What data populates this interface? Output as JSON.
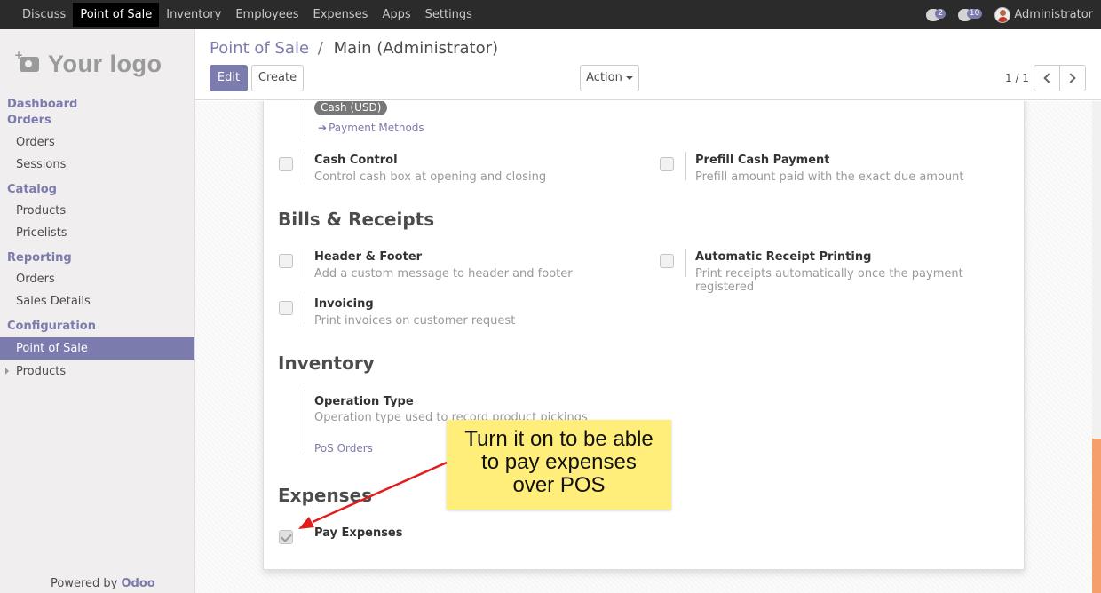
{
  "topbar": {
    "menu": [
      "Discuss",
      "Point of Sale",
      "Inventory",
      "Employees",
      "Expenses",
      "Apps",
      "Settings"
    ],
    "active_index": 1,
    "activity_count": "2",
    "messages_count": "10",
    "user": "Administrator"
  },
  "sidebar": {
    "logo_text": "Your logo",
    "groups": [
      {
        "header": "Dashboard",
        "items": []
      },
      {
        "header": "Orders",
        "items": [
          "Orders",
          "Sessions"
        ]
      },
      {
        "header": "Catalog",
        "items": [
          "Products",
          "Pricelists"
        ]
      },
      {
        "header": "Reporting",
        "items": [
          "Orders",
          "Sales Details"
        ]
      },
      {
        "header": "Configuration",
        "items": [
          "Point of Sale",
          "Products"
        ]
      }
    ],
    "powered_prefix": "Powered by",
    "powered_brand": "Odoo"
  },
  "control_panel": {
    "breadcrumb_parent": "Point of Sale",
    "breadcrumb_sep": "/",
    "breadcrumb_current": "Main (Administrator)",
    "edit_label": "Edit",
    "create_label": "Create",
    "action_label": "Action",
    "pager": "1 / 1"
  },
  "form": {
    "payment_tag": "Cash (USD)",
    "payment_methods_link": "Payment Methods",
    "cash_control": {
      "title": "Cash Control",
      "desc": "Control cash box at opening and closing",
      "checked": false
    },
    "prefill_cash": {
      "title": "Prefill Cash Payment",
      "desc": "Prefill amount paid with the exact due amount",
      "checked": false
    },
    "bills_section": "Bills & Receipts",
    "header_footer": {
      "title": "Header & Footer",
      "desc": "Add a custom message to header and footer",
      "checked": false
    },
    "auto_receipt": {
      "title": "Automatic Receipt Printing",
      "desc": "Print receipts automatically once the payment registered",
      "checked": false
    },
    "invoicing": {
      "title": "Invoicing",
      "desc": "Print invoices on customer request",
      "checked": false
    },
    "inventory_section": "Inventory",
    "operation_type": {
      "title": "Operation Type",
      "desc": "Operation type used to record product pickings",
      "value": "PoS Orders"
    },
    "expenses_section": "Expenses",
    "pay_expenses": {
      "title": "Pay Expenses",
      "checked": true
    }
  },
  "callout": {
    "lines": [
      "Turn it on to be able",
      "to pay expenses",
      "over POS"
    ],
    "color": "#ffef7a",
    "arrow_color": "#e41c1c"
  },
  "colors": {
    "brand": "#7c7bad",
    "topbar": "#2b2b2b"
  }
}
